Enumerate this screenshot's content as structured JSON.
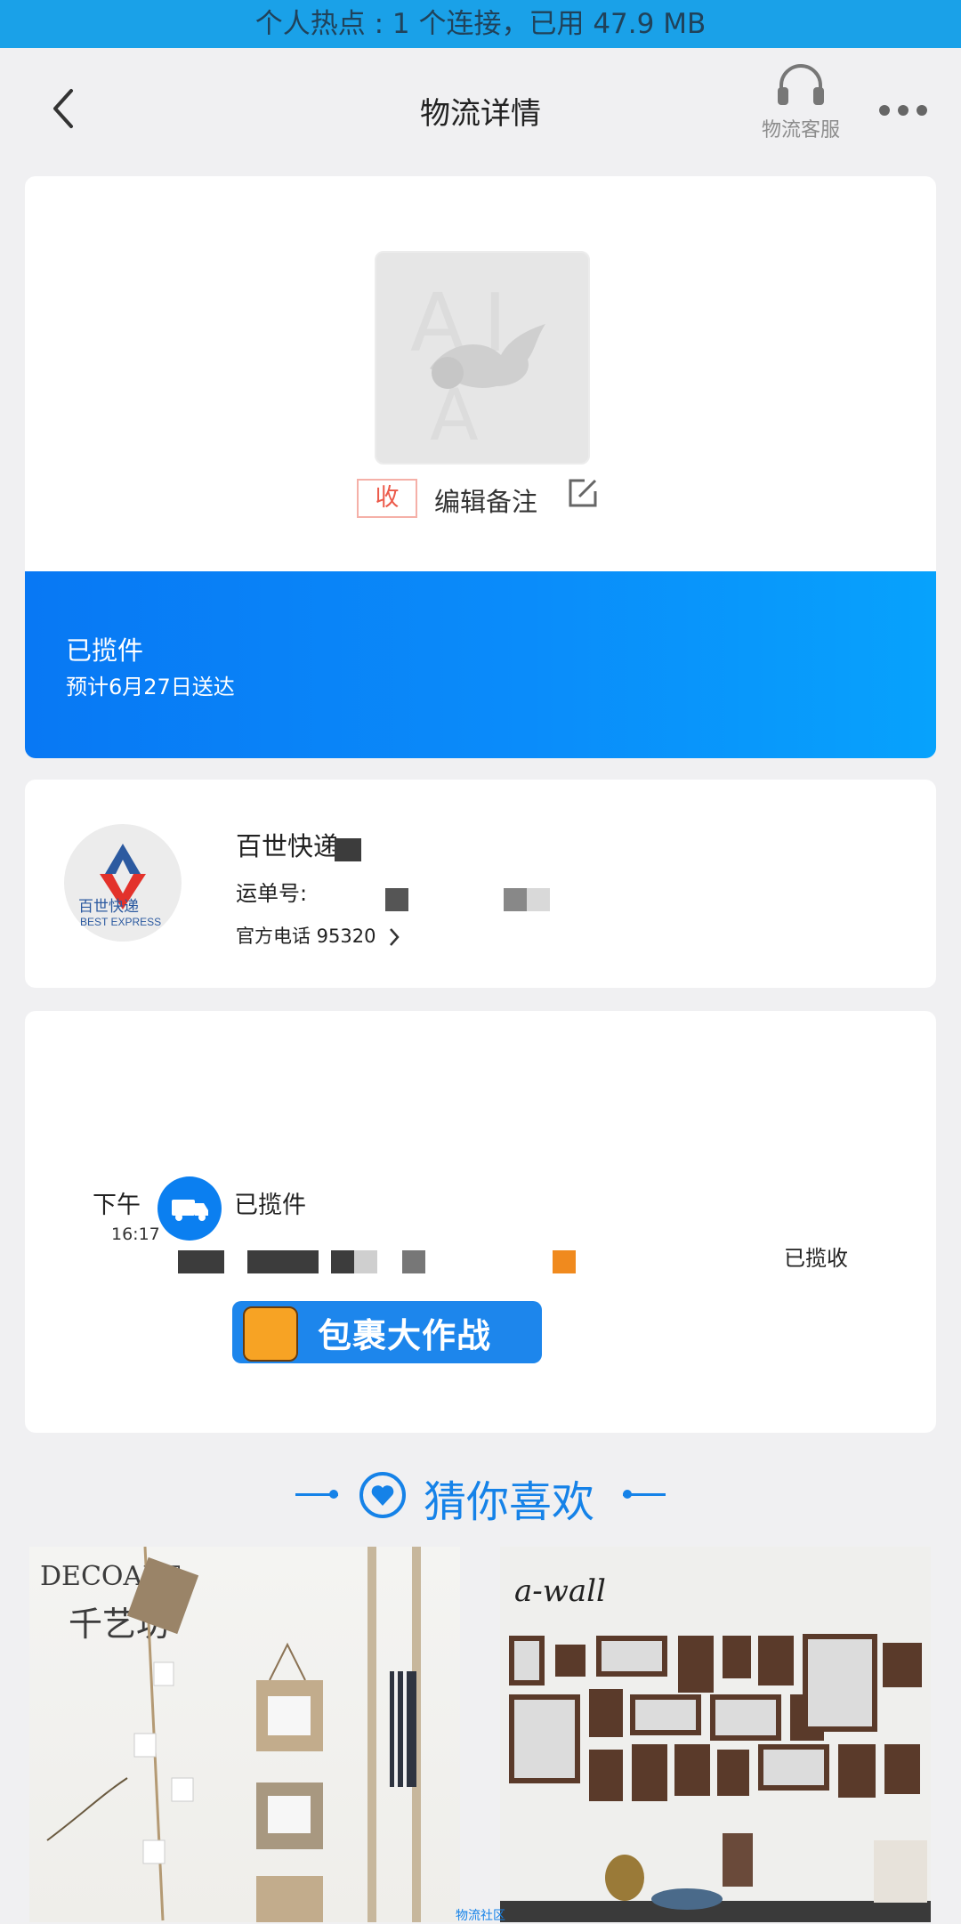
{
  "status_bar": {
    "text": "个人热点 : 1 个连接，已用 47.9 MB"
  },
  "nav": {
    "title": "物流详情",
    "service_label": "物流客服"
  },
  "package": {
    "tag": "收",
    "edit_note": "编辑备注",
    "status": "已揽件",
    "eta": "预计6月27日送达"
  },
  "courier": {
    "name": "百世快递",
    "logo_text_cn": "百世快递",
    "logo_text_en": "BEST EXPRESS",
    "waybill_label": "运单号:",
    "phone_label": "官方电话 95320"
  },
  "tracking": {
    "time_period": "下午",
    "time": "16:17",
    "status": "已揽件",
    "desc_tail": "已揽收",
    "promo_text": "包裹大作战"
  },
  "recommend": {
    "title": "猜你喜欢",
    "products": [
      {
        "brand": "DECOART",
        "brand_sub": "千艺坊"
      },
      {
        "brand": "a-wall"
      }
    ],
    "footer_note": "物流社区"
  },
  "colors": {
    "accent": "#0b7ff0",
    "status_bar": "#1aa1e8",
    "tag_red": "#ec5a4a"
  },
  "icons": [
    "back-arrow-icon",
    "headset-icon",
    "more-dots-icon",
    "edit-icon",
    "truck-icon",
    "heart-icon",
    "chevron-right-icon"
  ]
}
